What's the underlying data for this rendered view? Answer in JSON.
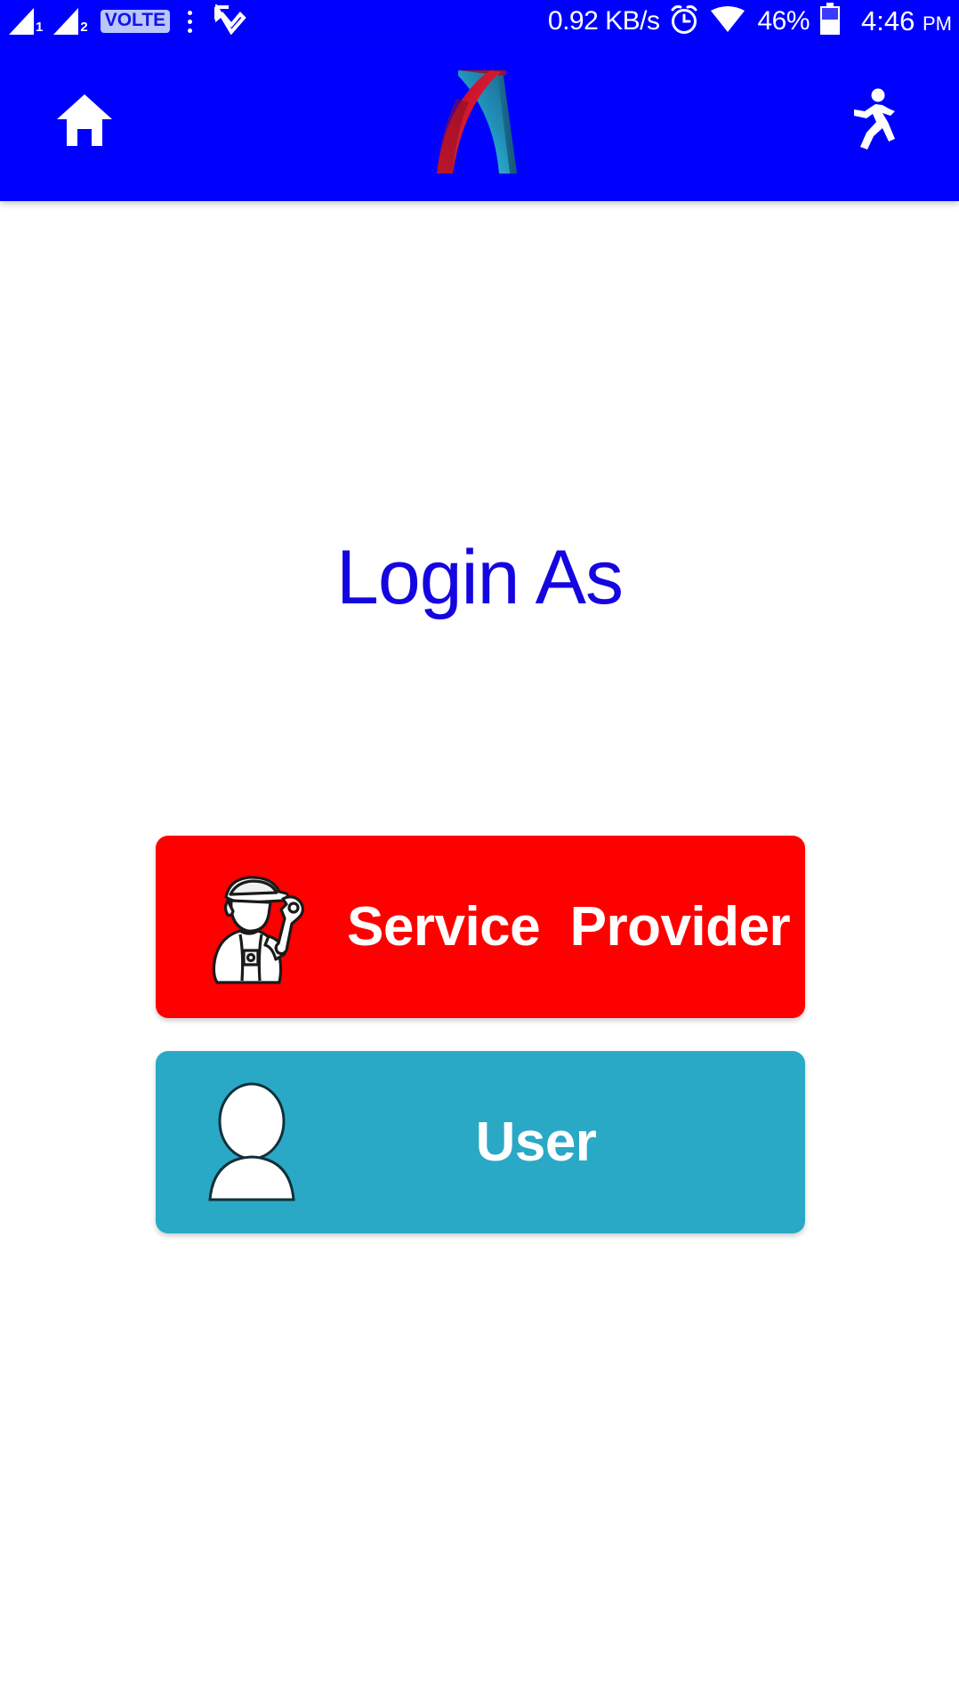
{
  "status_bar": {
    "sim1_label": "1",
    "sim2_label": "2",
    "volte_badge": "VOLTE",
    "network_speed": "0.92 KB/s",
    "battery_percent": "46%",
    "time": "4:46",
    "time_ampm": "PM",
    "icons": [
      "signal-bars-sim1",
      "signal-bars-sim2",
      "volte-badge",
      "overflow-dots",
      "download-arrow",
      "alarm-clock",
      "wifi",
      "battery"
    ],
    "background_color": "#0000FF",
    "foreground_color": "#FFFFFF"
  },
  "app_bar": {
    "home_icon": "home-icon",
    "logo_icon": "brand-arch-logo",
    "exit_icon": "running-person-icon",
    "background_color": "#0000FF",
    "logo_colors": {
      "left_ribbon": "#C8102E",
      "right_ribbon": "#1B9FC8"
    }
  },
  "main": {
    "title": "Login As",
    "title_color": "#1505E0",
    "options": [
      {
        "label": "Service  Provider",
        "icon": "mechanic-worker-icon",
        "background_color": "#FF0000",
        "text_color": "#FFFFFF"
      },
      {
        "label": "User",
        "icon": "person-avatar-icon",
        "background_color": "#29A9C6",
        "text_color": "#FFFFFF"
      }
    ]
  }
}
